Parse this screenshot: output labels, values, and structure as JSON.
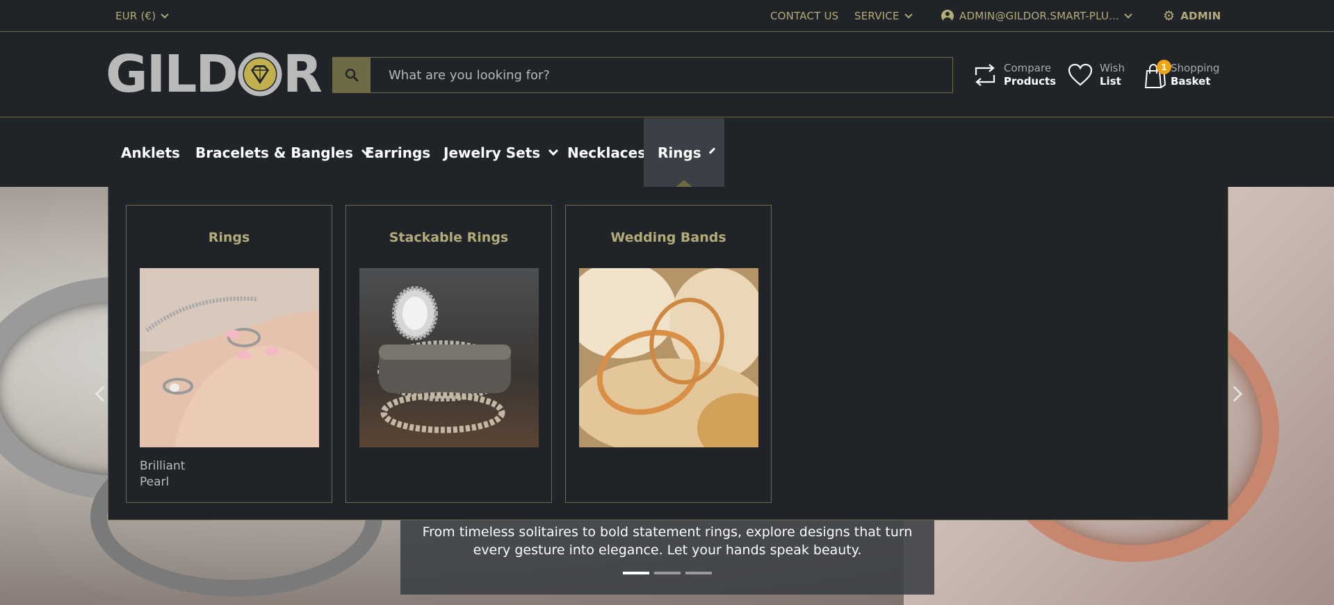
{
  "topbar": {
    "currency": "EUR  (€)",
    "contact": "CONTACT US",
    "service": "SERVICE",
    "account": "ADMIN@GILDOR.SMART-PLU...",
    "admin": "ADMIN"
  },
  "brand": {
    "logo_text_left": "GILD",
    "logo_text_right": "R",
    "gem_color": "#c2b04e"
  },
  "search": {
    "placeholder": "What are you looking for?"
  },
  "header_links": {
    "compare": {
      "line1": "Compare",
      "line2": "Products"
    },
    "wish": {
      "line1": "Wish",
      "line2": "List"
    },
    "basket": {
      "line1": "Shopping",
      "line2": "Basket",
      "count": "1"
    }
  },
  "nav": {
    "items": [
      {
        "label": "Anklets"
      },
      {
        "label": "Bracelets & Bangles"
      },
      {
        "label": "Earrings"
      },
      {
        "label": "Jewelry Sets"
      },
      {
        "label": "Necklaces"
      },
      {
        "label": "Rings"
      }
    ]
  },
  "mega_menu": {
    "cards": [
      {
        "title": "Rings",
        "subitems": [
          "Brilliant",
          "Pearl"
        ]
      },
      {
        "title": "Stackable Rings"
      },
      {
        "title": "Wedding Bands"
      }
    ]
  },
  "hero": {
    "caption": "From timeless solitaires to bold statement rings, explore designs that turn every gesture into elegance. Let your hands speak beauty.",
    "active_slide": 1,
    "slide_count": 3
  },
  "colors": {
    "accent": "#b3ac79",
    "border": "#6e6a45",
    "background": "#202428",
    "badge": "#f0a313"
  }
}
